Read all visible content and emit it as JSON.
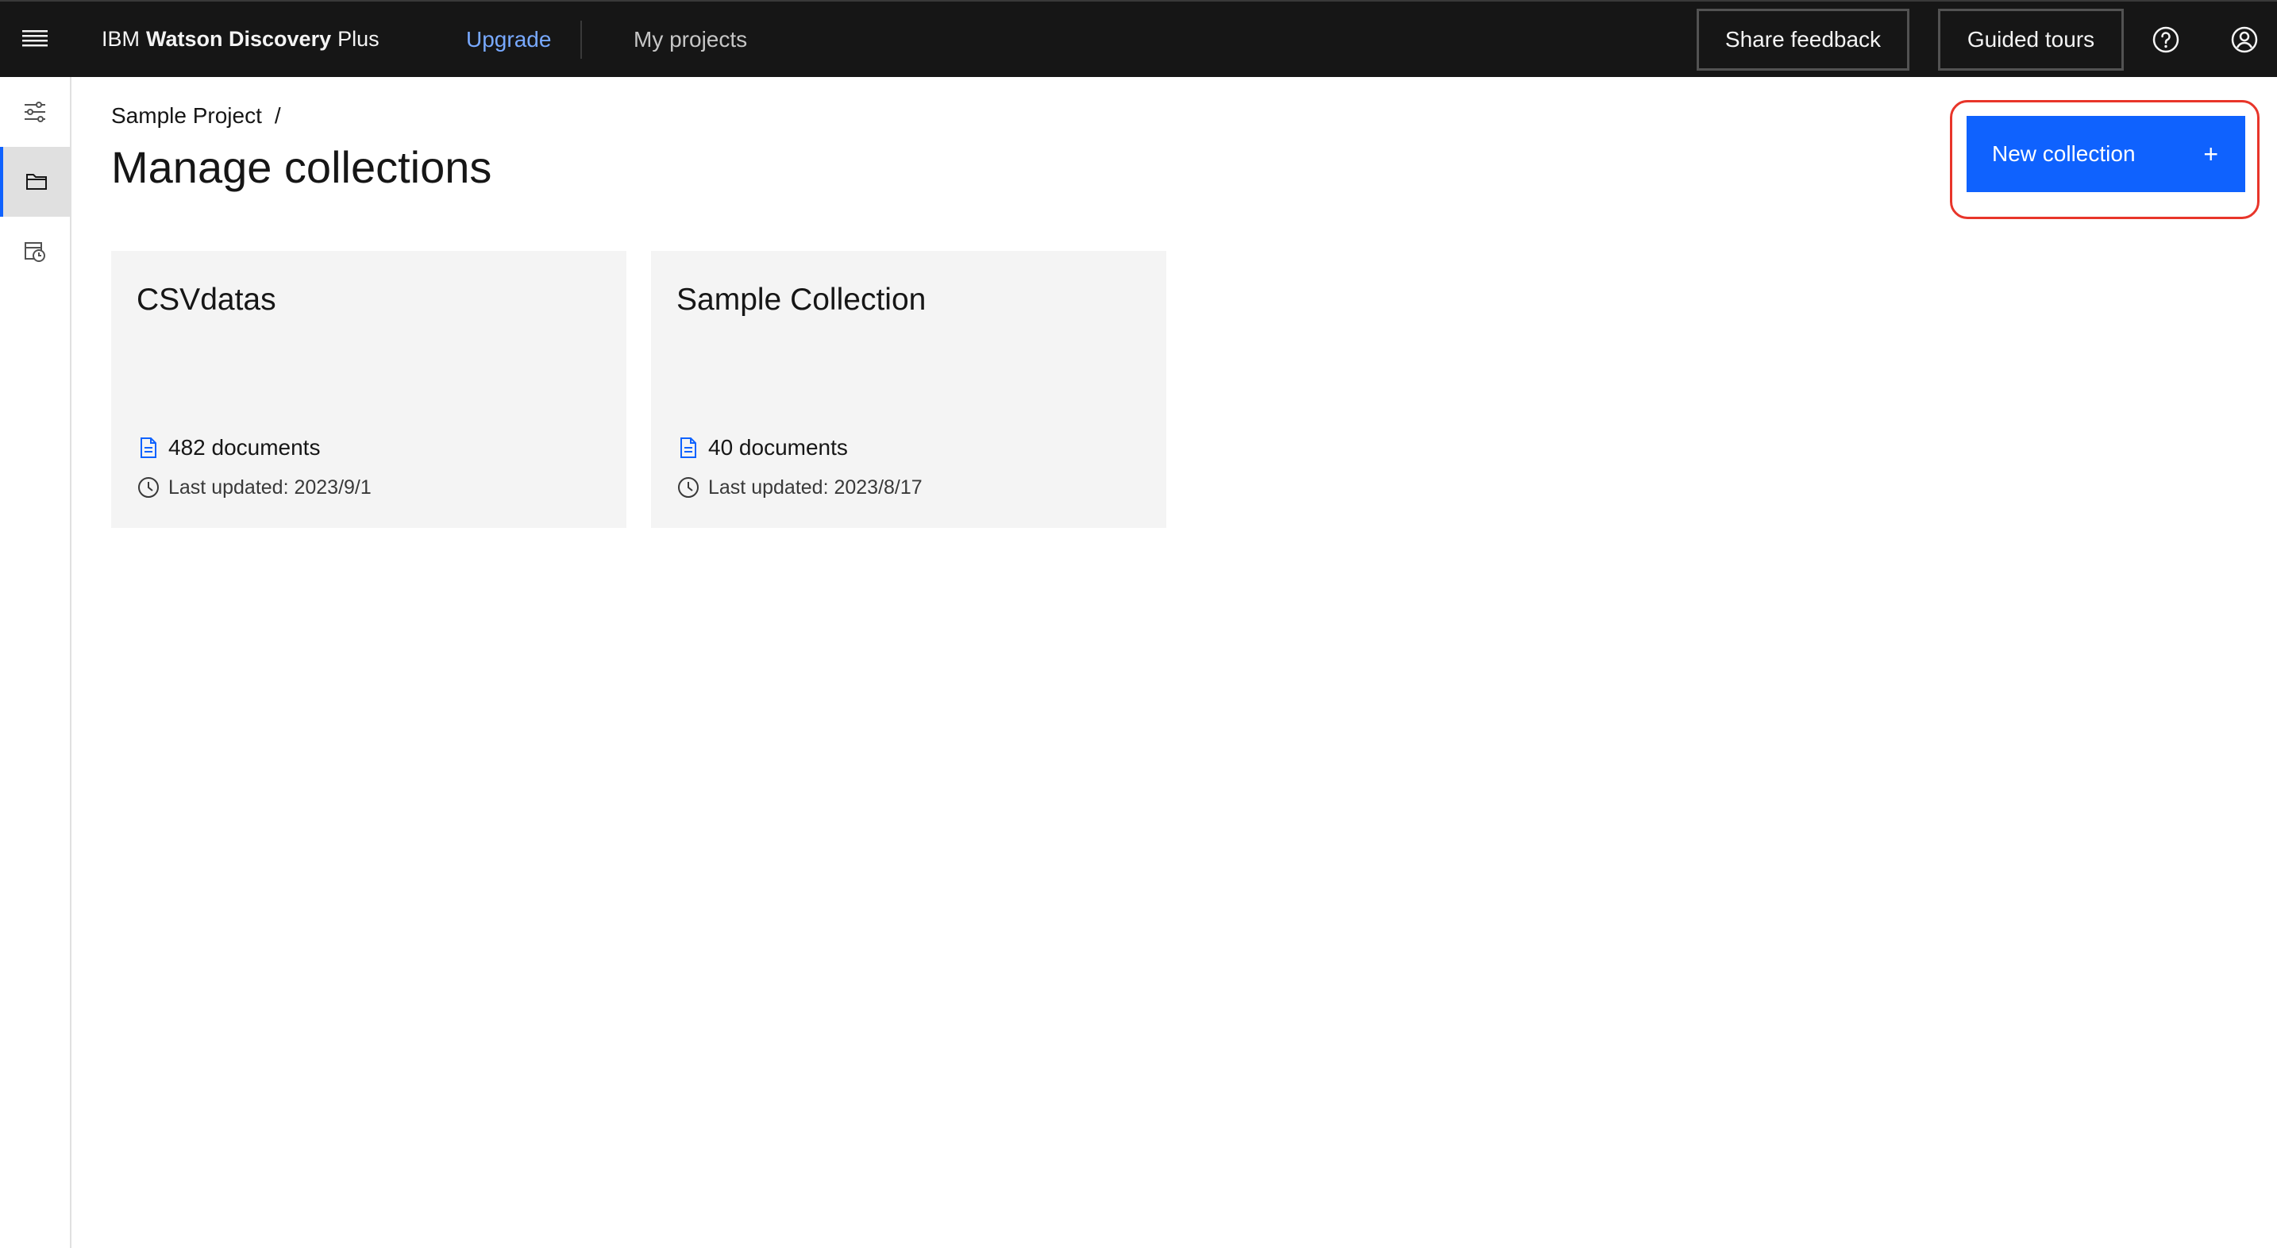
{
  "header": {
    "brand_prefix": "IBM",
    "brand_bold": "Watson Discovery",
    "brand_suffix": "Plus",
    "nav_upgrade": "Upgrade",
    "nav_my_projects": "My projects",
    "share_feedback": "Share feedback",
    "guided_tours": "Guided tours",
    "icons": [
      "menu-icon",
      "help-icon",
      "user-avatar-icon"
    ],
    "upgrade_color": "#78a9ff"
  },
  "siderail": {
    "items": [
      {
        "icon": "settings-adjust-icon",
        "active": false
      },
      {
        "icon": "folder-icon",
        "active": true
      },
      {
        "icon": "data-scheduled-icon",
        "active": false
      }
    ]
  },
  "main": {
    "breadcrumb": {
      "project": "Sample Project",
      "separator": "/"
    },
    "title": "Manage collections",
    "new_collection_label": "New collection",
    "new_collection_icon": "+",
    "primary_color": "#0f62fe",
    "highlight_color": "#e8352a"
  },
  "collections": [
    {
      "name": "CSVdatas",
      "documents": "482 documents",
      "updated": "Last updated: 2023/9/1"
    },
    {
      "name": "Sample Collection",
      "documents": "40 documents",
      "updated": "Last updated: 2023/8/17"
    }
  ]
}
